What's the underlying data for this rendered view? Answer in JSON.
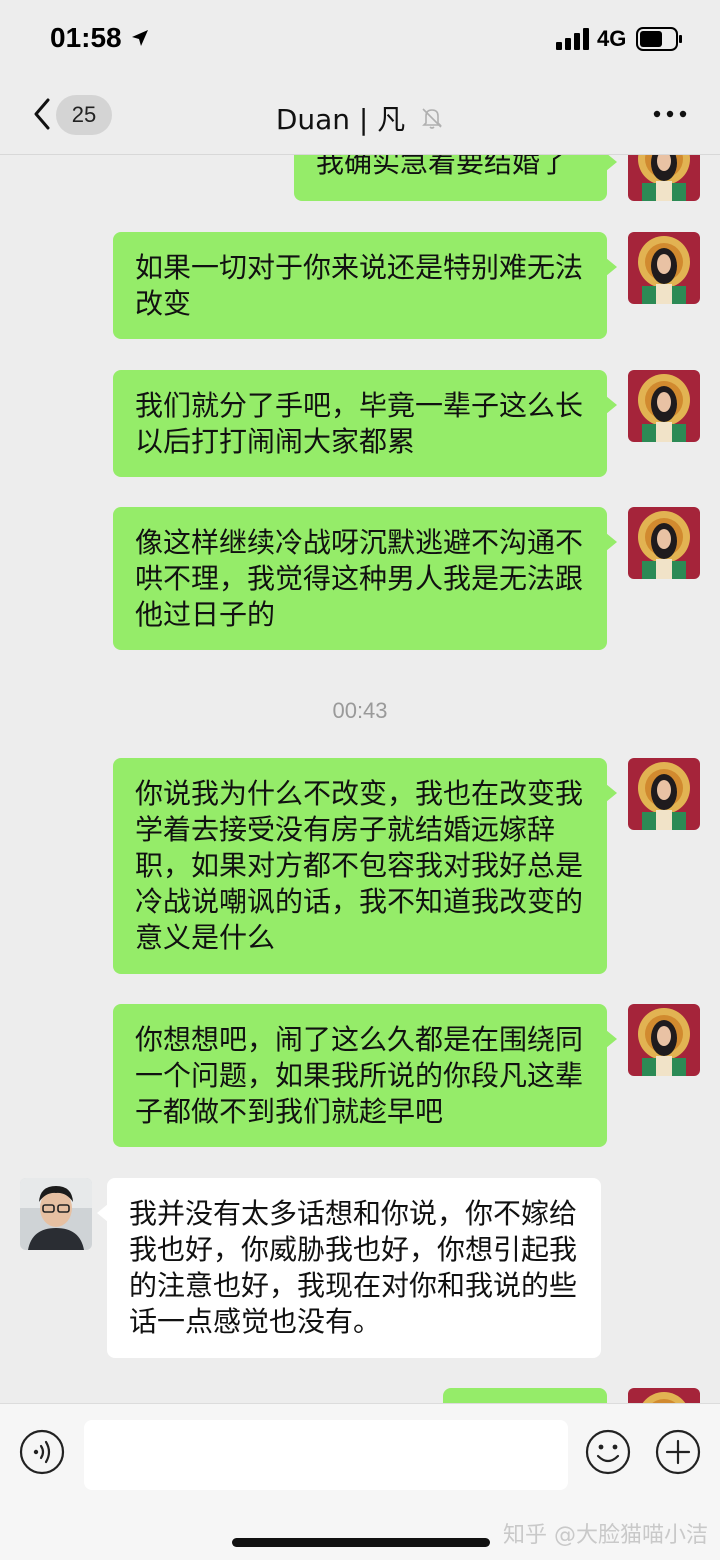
{
  "status_bar": {
    "time": "01:58",
    "network": "4G"
  },
  "header": {
    "unread_count": "25",
    "title": "Duan | 凡"
  },
  "messages": [
    {
      "side": "right",
      "text": "我确实急着要结婚了"
    },
    {
      "side": "right",
      "text": "如果一切对于你来说还是特别难无法改变"
    },
    {
      "side": "right",
      "text": "我们就分了手吧，毕竟一辈子这么长以后打打闹闹大家都累"
    },
    {
      "side": "right",
      "text": "像这样继续冷战呀沉默逃避不沟通不哄不理，我觉得这种男人我是无法跟他过日子的"
    },
    {
      "side": "right",
      "text": "你说我为什么不改变，我也在改变我学着去接受没有房子就结婚远嫁辞职，如果对方都不包容我对我好总是冷战说嘲讽的话，我不知道我改变的意义是什么"
    },
    {
      "side": "right",
      "text": "你想想吧，闹了这么久都是在围绕同一个问题，如果我所说的你段凡这辈子都做不到我们就趁早吧"
    },
    {
      "side": "left",
      "text": "我并没有太多话想和你说，你不嫁给我也好，你威胁我也好，你想引起我的注意也好，我现在对你和我说的些话一点感觉也没有。"
    }
  ],
  "timestamp": "00:43",
  "watermark": "知乎 @大脸猫喵小洁",
  "colors": {
    "sent_bubble": "#95ec69",
    "received_bubble": "#ffffff",
    "background": "#ededed"
  },
  "icons": [
    "location-arrow-icon",
    "signal-icon",
    "battery-icon",
    "back-chevron-icon",
    "mute-bell-icon",
    "more-icon",
    "voice-icon",
    "emoji-icon",
    "plus-icon"
  ]
}
